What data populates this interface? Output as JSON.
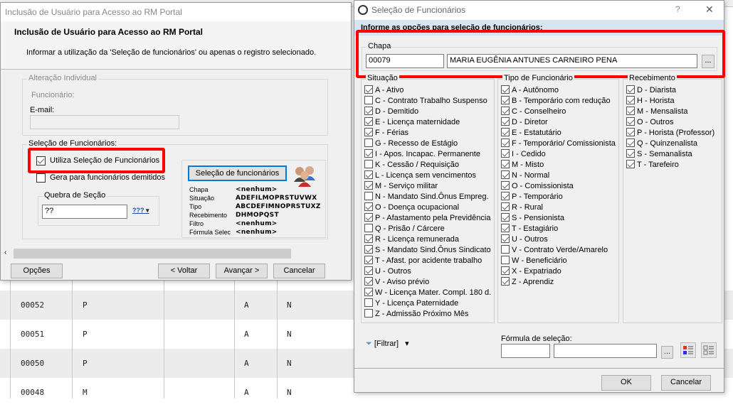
{
  "background_grid": {
    "rows": [
      {
        "code": "00052",
        "type": "P",
        "status": "A",
        "flag": "N"
      },
      {
        "code": "00051",
        "type": "P",
        "status": "A",
        "flag": "N"
      },
      {
        "code": "00050",
        "type": "P",
        "status": "A",
        "flag": "N"
      },
      {
        "code": "00048",
        "type": "M",
        "status": "A",
        "flag": "N"
      }
    ]
  },
  "wizard": {
    "window_title": "Inclusão de Usuário para Acesso ao RM Portal",
    "header_title": "Inclusão de Usuário para Acesso ao RM Portal",
    "header_subtitle": "Informar a utilização da 'Seleção de funcionários' ou apenas o registro selecionado.",
    "individual": {
      "legend": "Alteração Individual",
      "employee_label": "Funcionário:",
      "email_label": "E-mail:",
      "email_value": ""
    },
    "selection": {
      "legend": "Seleção de Funcionários:",
      "use_selection_label": "Utiliza Seleção de Funcionários",
      "use_selection_checked": true,
      "include_dismissed_label": "Gera para funcionários demitidos",
      "include_dismissed_checked": false,
      "section_break_legend": "Quebra de Seção",
      "section_break_value": "??",
      "section_break_icon": "???",
      "selection_button": "Seleção de funcionários",
      "summary": [
        {
          "label": "Chapa",
          "value": "<nenhum>"
        },
        {
          "label": "Situação",
          "value": "ADEFILMOPRSTUVWX"
        },
        {
          "label": "Tipo",
          "value": "ABCDEFIMNOPRSTUXZ"
        },
        {
          "label": "Recebimento",
          "value": "DHMOPQST"
        },
        {
          "label": "Filtro",
          "value": "<nenhum>"
        },
        {
          "label": "Fórmula Selec",
          "value": "<nenhum>"
        }
      ]
    },
    "buttons": {
      "options": "Opções",
      "back": "< Voltar",
      "next": "Avançar >",
      "cancel": "Cancelar"
    }
  },
  "selector": {
    "window_title": "Seleção de Funcionários",
    "help": "?",
    "close": "✕",
    "instructions": "Informe as opções para seleção de funcionários:",
    "chapa": {
      "legend": "Chapa",
      "code": "00079",
      "name": "MARIA EUGÊNIA ANTUNES CARNEIRO PENA",
      "lookup": "..."
    },
    "situacao": {
      "legend": "Situação",
      "items": [
        {
          "label": "A - Ativo",
          "checked": true
        },
        {
          "label": "C - Contrato Trabalho Suspenso",
          "checked": false
        },
        {
          "label": "D - Demitido",
          "checked": true
        },
        {
          "label": "E - Licença maternidade",
          "checked": true
        },
        {
          "label": "F - Férias",
          "checked": true
        },
        {
          "label": "G - Recesso de Estágio",
          "checked": false
        },
        {
          "label": "I - Apos. Incapac. Permanente",
          "checked": true
        },
        {
          "label": "K - Cessão / Requisição",
          "checked": false
        },
        {
          "label": "L - Licença sem vencimentos",
          "checked": true
        },
        {
          "label": "M - Serviço militar",
          "checked": true
        },
        {
          "label": "N - Mandato Sind.Ônus Empreg.",
          "checked": false
        },
        {
          "label": "O - Doença ocupacional",
          "checked": true
        },
        {
          "label": "P - Afastamento pela Previdência",
          "checked": true
        },
        {
          "label": "Q - Prisão / Cárcere",
          "checked": false
        },
        {
          "label": "R - Licença remunerada",
          "checked": true
        },
        {
          "label": "S - Mandato Sind.Ônus Sindicato",
          "checked": true
        },
        {
          "label": "T - Afast. por acidente trabalho",
          "checked": true
        },
        {
          "label": "U - Outros",
          "checked": true
        },
        {
          "label": "V - Aviso prévio",
          "checked": true
        },
        {
          "label": "W - Licença Mater. Compl. 180 d.",
          "checked": true
        },
        {
          "label": "Y - Licença Paternidade",
          "checked": false
        },
        {
          "label": "Z - Admissão Próximo Mês",
          "checked": false
        }
      ]
    },
    "tipo": {
      "legend": "Tipo de Funcionário",
      "items": [
        {
          "label": "A - Autônomo",
          "checked": true
        },
        {
          "label": "B - Temporário com redução",
          "checked": true
        },
        {
          "label": "C - Conselheiro",
          "checked": true
        },
        {
          "label": "D - Diretor",
          "checked": true
        },
        {
          "label": "E - Estatutário",
          "checked": true
        },
        {
          "label": "F - Temporário/ Comissionista",
          "checked": true
        },
        {
          "label": "I - Cedido",
          "checked": true
        },
        {
          "label": "M - Misto",
          "checked": true
        },
        {
          "label": "N - Normal",
          "checked": true
        },
        {
          "label": "O - Comissionista",
          "checked": true
        },
        {
          "label": "P - Temporário",
          "checked": true
        },
        {
          "label": "R - Rural",
          "checked": true
        },
        {
          "label": "S - Pensionista",
          "checked": true
        },
        {
          "label": "T - Estagiário",
          "checked": true
        },
        {
          "label": "U - Outros",
          "checked": true
        },
        {
          "label": "V - Contrato Verde/Amarelo",
          "checked": false
        },
        {
          "label": "W - Beneficiário",
          "checked": false
        },
        {
          "label": "X - Expatriado",
          "checked": true
        },
        {
          "label": "Z - Aprendiz",
          "checked": true
        }
      ]
    },
    "recebimento": {
      "legend": "Recebimento",
      "items": [
        {
          "label": "D - Diarista",
          "checked": true
        },
        {
          "label": "H - Horista",
          "checked": true
        },
        {
          "label": "M - Mensalista",
          "checked": true
        },
        {
          "label": "O - Outros",
          "checked": true
        },
        {
          "label": "P - Horista (Professor)",
          "checked": true
        },
        {
          "label": "Q - Quinzenalista",
          "checked": true
        },
        {
          "label": "S - Semanalista",
          "checked": true
        },
        {
          "label": "T - Tarefeiro",
          "checked": true
        }
      ]
    },
    "filter_label": "[Filtrar]",
    "formula_label": "Fórmula de seleção:",
    "formula_code": "",
    "formula_desc": "",
    "formula_lookup": "...",
    "ok": "OK",
    "cancel": "Cancelar"
  },
  "colors": {
    "highlight": "#ff0000",
    "band": "#d7e4f2",
    "accent": "#0078d7"
  }
}
